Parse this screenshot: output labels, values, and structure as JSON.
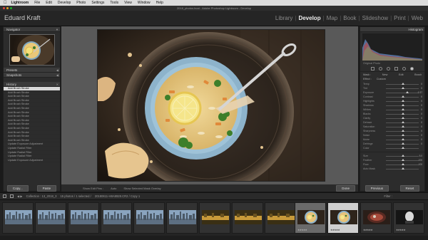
{
  "menubar": {
    "app": "Lightroom",
    "items": [
      "File",
      "Edit",
      "Develop",
      "Photo",
      "Settings",
      "Tools",
      "View",
      "Window",
      "Help"
    ]
  },
  "window_title": "2018_photos.lrcat - Adobe Photoshop Lightroom - Develop",
  "identity": "Eduard Kraft",
  "modules": [
    "Library",
    "Develop",
    "Map",
    "Book",
    "Slideshow",
    "Print",
    "Web"
  ],
  "active_module": "Develop",
  "left_panel": {
    "navigator": "Navigator",
    "presets": "Presets",
    "snapshots": "Snapshots",
    "history": "History",
    "history_items": [
      "Add Brush Stroke",
      "Add Brush Stroke",
      "Add Brush Stroke",
      "Add Brush Stroke",
      "Add Brush Stroke",
      "Add Brush Stroke",
      "Add Brush Stroke",
      "Add Brush Stroke",
      "Add Brush Stroke",
      "Add Brush Stroke",
      "Add Brush Stroke",
      "Add Brush Stroke",
      "Add Brush Stroke",
      "Add Brush Stroke",
      "Update Exposure Adjustment",
      "Update Radial Filter",
      "Update Radial Filter",
      "Update Radial Filter",
      "Update Exposure Adjustment"
    ],
    "copy_label": "Copy...",
    "paste_label": "Paste"
  },
  "toolbar": {
    "show_edit_pins": "Show Edit Pins :",
    "pins_value": "Auto",
    "show_overlay": "Show Selected Mask Overlay",
    "done": "Done"
  },
  "right_panel": {
    "histogram": "Histogram",
    "original_photo": "Original Photo",
    "mask": "Mask :",
    "new": "New",
    "edit": "Edit",
    "brush": "Brush",
    "effect": "Effect :",
    "custom": "Custom",
    "sliders": [
      {
        "label": "Temp",
        "value": "0"
      },
      {
        "label": "Tint",
        "value": "0"
      },
      {
        "label": "Exposure",
        "value": "0.37"
      },
      {
        "label": "Contrast",
        "value": "0"
      },
      {
        "label": "Highlights",
        "value": "0"
      },
      {
        "label": "Shadows",
        "value": "0"
      },
      {
        "label": "Whites",
        "value": "0"
      },
      {
        "label": "Blacks",
        "value": "0"
      },
      {
        "label": "Clarity",
        "value": "0"
      },
      {
        "label": "Dehaze",
        "value": "0"
      },
      {
        "label": "Saturation",
        "value": "0"
      },
      {
        "label": "Sharpness",
        "value": "0"
      },
      {
        "label": "Noise",
        "value": "0"
      },
      {
        "label": "Moire",
        "value": "0"
      },
      {
        "label": "Defringe",
        "value": "0"
      },
      {
        "label": "Color",
        "value": ""
      }
    ],
    "brush_sliders": [
      {
        "label": "Size",
        "value": "5.0"
      },
      {
        "label": "Feather",
        "value": "100"
      },
      {
        "label": "Flow",
        "value": "100"
      },
      {
        "label": "Auto Mask",
        "value": ""
      }
    ],
    "previous": "Previous",
    "reset": "Reset"
  },
  "infobar": {
    "collection": "Collection : 13_2018_3",
    "count": "15 photos / 1 selected /",
    "filename": "20180611-H8A8928.CR2 / Copy 1",
    "filter": "Filter :"
  },
  "filmstrip": [
    {
      "kind": "city",
      "stars": ""
    },
    {
      "kind": "city",
      "stars": ""
    },
    {
      "kind": "city",
      "stars": ""
    },
    {
      "kind": "city",
      "stars": ""
    },
    {
      "kind": "city",
      "stars": ""
    },
    {
      "kind": "city",
      "stars": ""
    },
    {
      "kind": "gold",
      "stars": ""
    },
    {
      "kind": "gold",
      "stars": ""
    },
    {
      "kind": "gold",
      "stars": ""
    },
    {
      "kind": "soup",
      "stars": "★★★★★"
    },
    {
      "kind": "soup",
      "stars": "★★★★★"
    },
    {
      "kind": "red",
      "stars": "★★★★★"
    },
    {
      "kind": "dark",
      "stars": "★★★★★"
    }
  ],
  "colors": {
    "accent": "#eeeeee",
    "panel": "#2c2c2c",
    "selected": "#d8d8d8"
  }
}
